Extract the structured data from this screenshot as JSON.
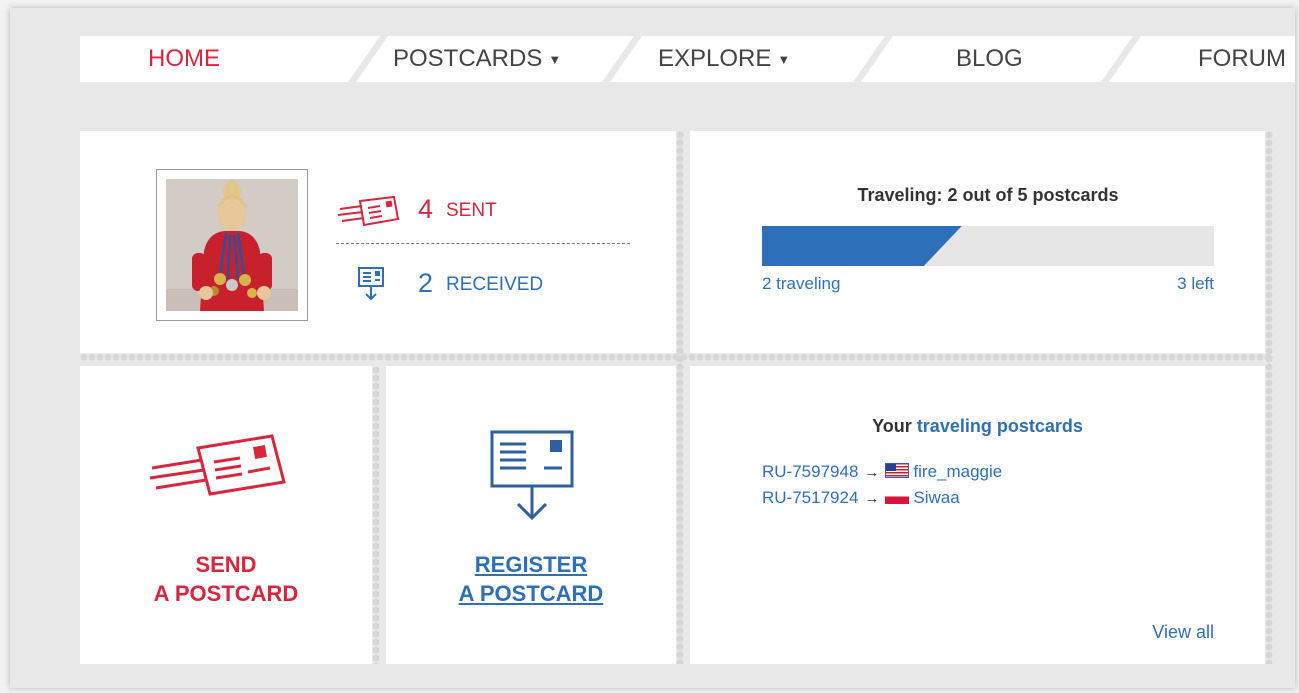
{
  "nav": {
    "items": [
      {
        "label": "HOME",
        "active": true
      },
      {
        "label": "POSTCARDS",
        "dropdown": true
      },
      {
        "label": "EXPLORE",
        "dropdown": true
      },
      {
        "label": "BLOG"
      },
      {
        "label": "FORUM"
      }
    ],
    "caret": "▼"
  },
  "profile": {
    "sent_count": "4",
    "sent_label": "SENT",
    "received_count": "2",
    "received_label": "RECEIVED"
  },
  "progress": {
    "title": "Traveling: 2 out of 5 postcards",
    "traveling": 2,
    "total": 5,
    "traveling_label": "2 traveling",
    "left_label": "3 left"
  },
  "actions": {
    "send_line1": "SEND",
    "send_line2": "A POSTCARD",
    "register_line1": "REGISTER",
    "register_line2": "A POSTCARD"
  },
  "traveling": {
    "title_prefix": "Your",
    "title_link": "traveling postcards",
    "arrow": "→",
    "postcards": [
      {
        "code": "RU-7597948",
        "flag": "us-flag-icon",
        "user": "fire_maggie"
      },
      {
        "code": "RU-7517924",
        "flag": "pl-flag-icon",
        "user": "Siwaa"
      }
    ],
    "view_all": "View all"
  },
  "colors": {
    "red": "#d7263d",
    "blue": "#2f6fb8",
    "progress_blue": "#2e6fba",
    "dot_gray": "#d6d6d6"
  }
}
